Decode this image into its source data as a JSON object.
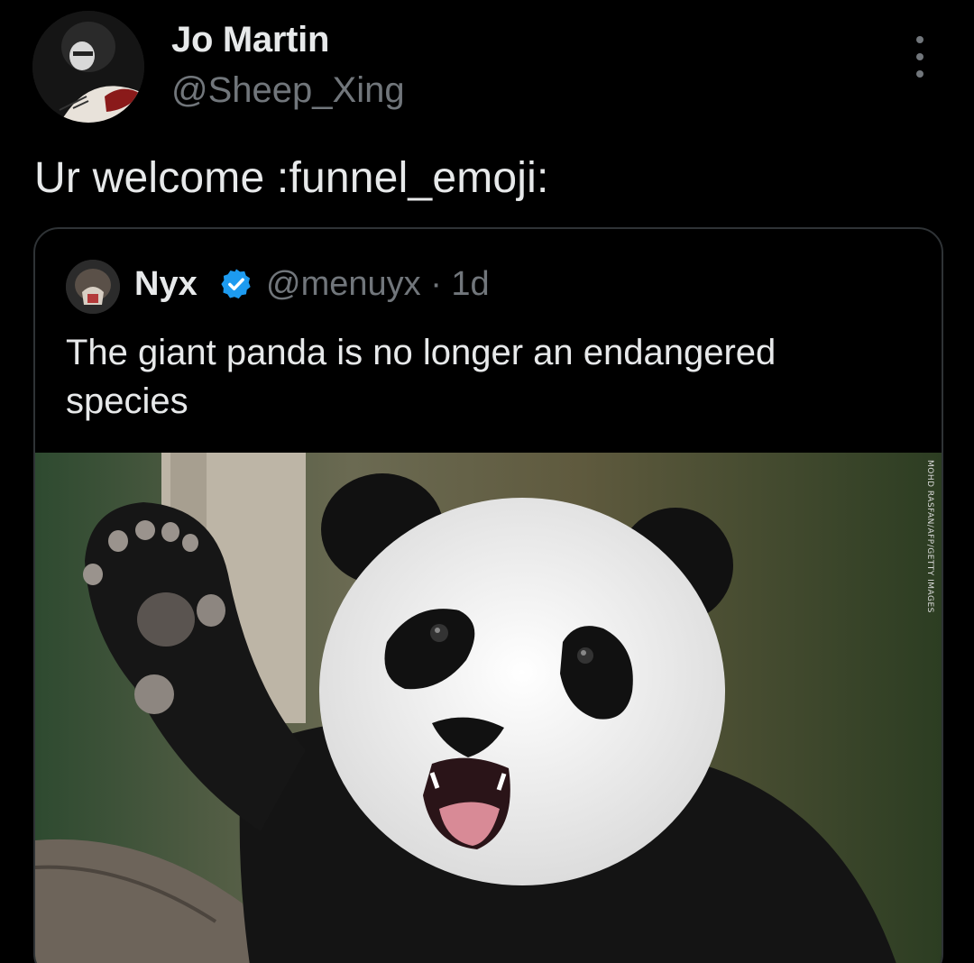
{
  "post": {
    "author": {
      "name": "Jo Martin",
      "handle": "@Sheep_Xing"
    },
    "text": "Ur welcome :funnel_emoji:",
    "more_icon": "more-options-icon"
  },
  "quoted_post": {
    "author": {
      "name": "Nyx",
      "handle_time": "@menuyx · 1d",
      "verified": true
    },
    "text": "The giant panda is no longer an endangered species",
    "image": {
      "subject": "giant panda waving",
      "credit": "MOHD RASFAN/AFP/GETTY IMAGES"
    }
  },
  "colors": {
    "background": "#000000",
    "primary_text": "#e7e9ea",
    "secondary_text": "#71767b",
    "border": "#2f3336",
    "verified_blue": "#1d9bf0"
  }
}
